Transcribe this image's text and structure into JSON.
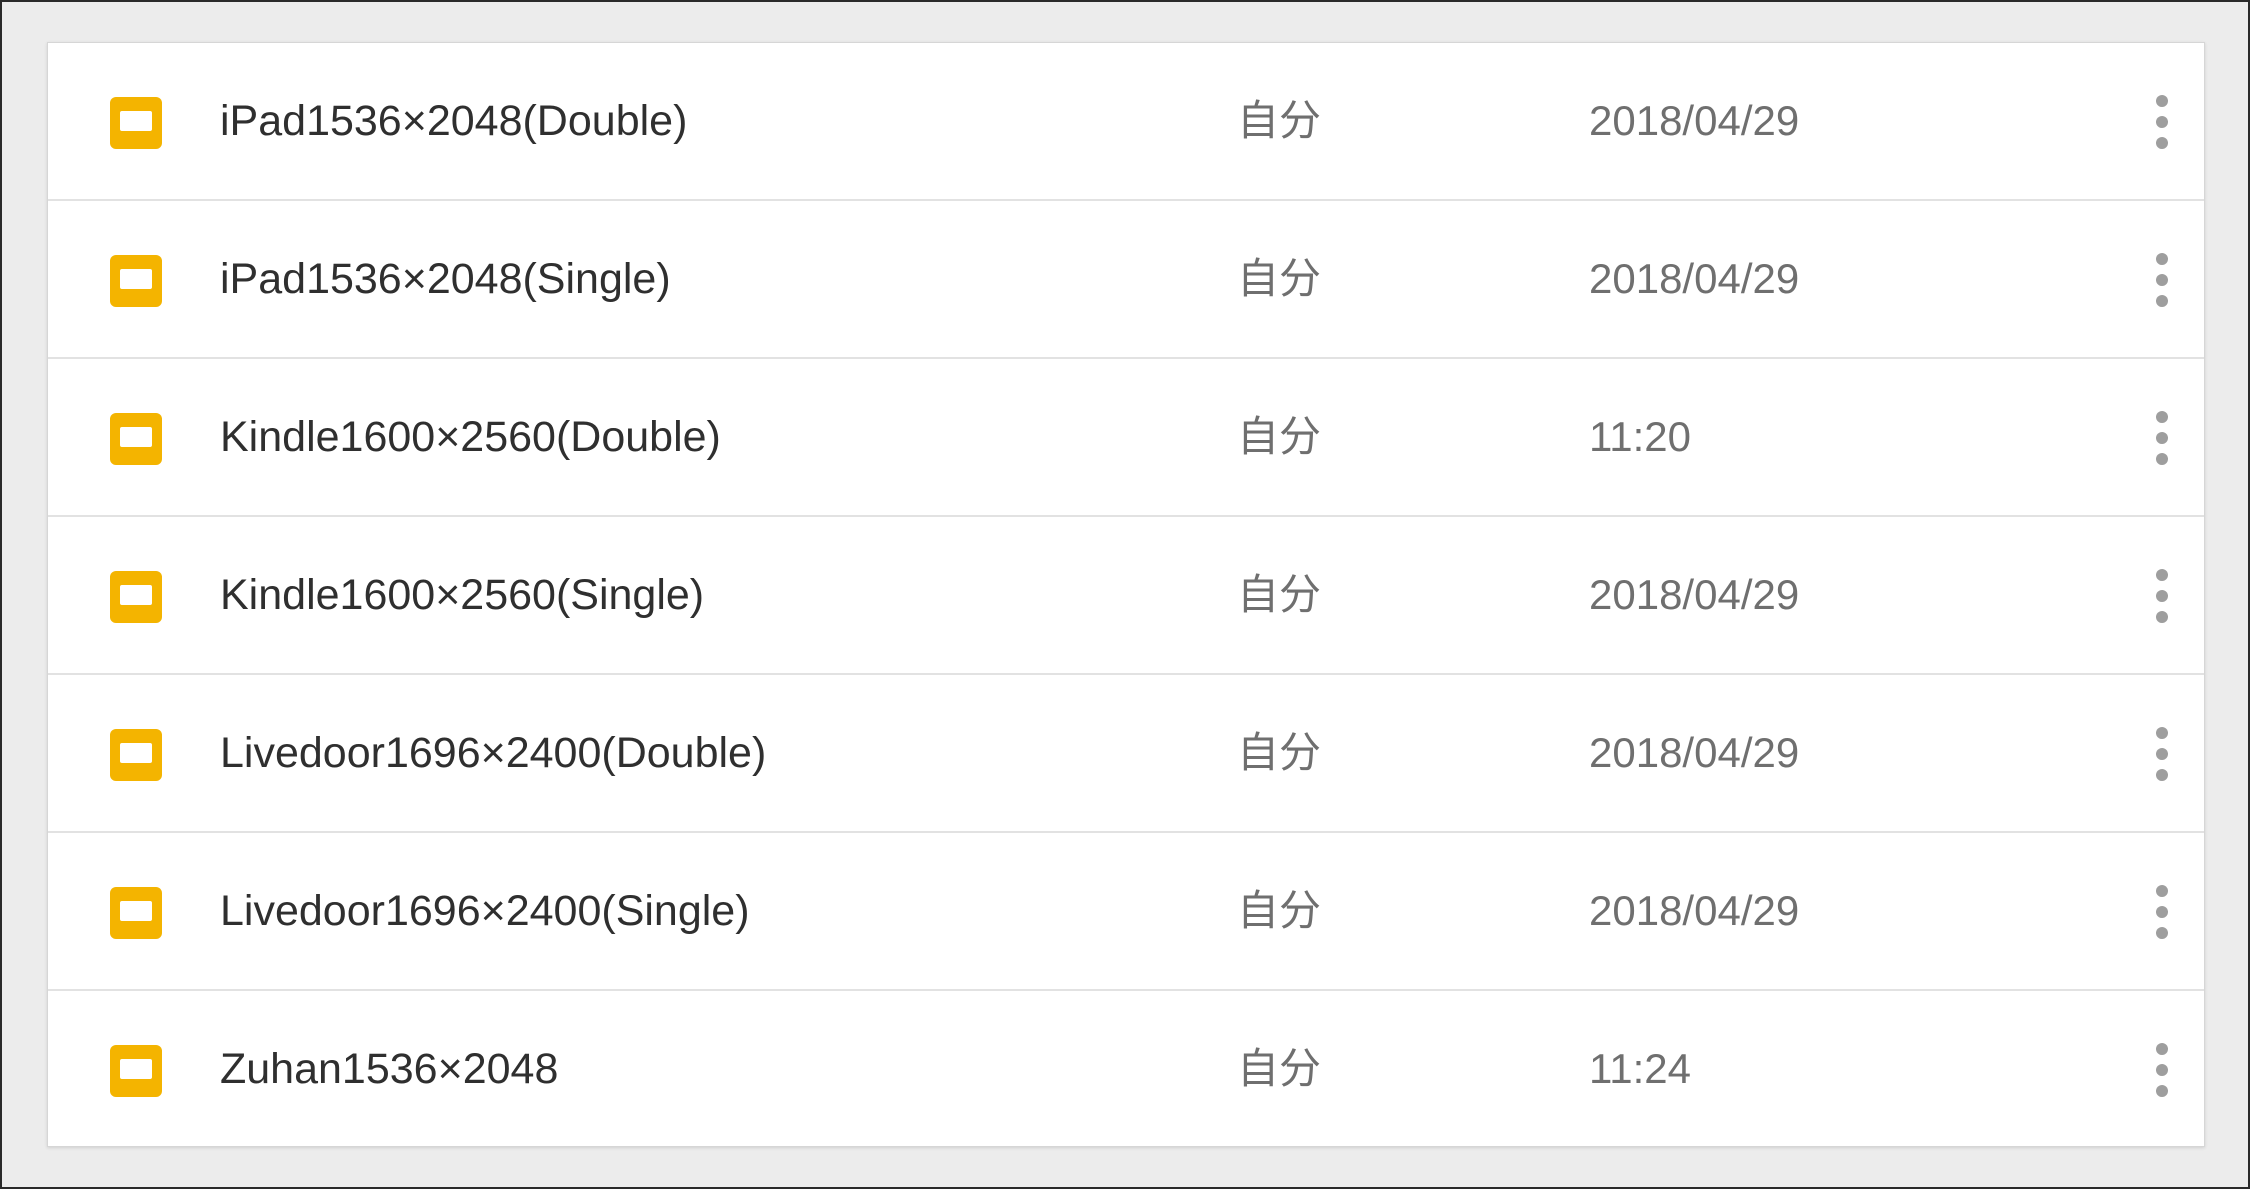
{
  "files": [
    {
      "name": "iPad1536×2048(Double)",
      "owner": "自分",
      "modified": "2018/04/29",
      "icon": "slides-icon"
    },
    {
      "name": "iPad1536×2048(Single)",
      "owner": "自分",
      "modified": "2018/04/29",
      "icon": "slides-icon"
    },
    {
      "name": "Kindle1600×2560(Double)",
      "owner": "自分",
      "modified": "11:20",
      "icon": "slides-icon"
    },
    {
      "name": "Kindle1600×2560(Single)",
      "owner": "自分",
      "modified": "2018/04/29",
      "icon": "slides-icon"
    },
    {
      "name": "Livedoor1696×2400(Double)",
      "owner": "自分",
      "modified": "2018/04/29",
      "icon": "slides-icon"
    },
    {
      "name": "Livedoor1696×2400(Single)",
      "owner": "自分",
      "modified": "2018/04/29",
      "icon": "slides-icon"
    },
    {
      "name": "Zuhan1536×2048",
      "owner": "自分",
      "modified": "11:24",
      "icon": "slides-icon"
    }
  ],
  "colors": {
    "icon": "#f4b400",
    "background": "#ececec",
    "list_background": "#ffffff",
    "name_text": "#2f2f2f",
    "meta_text": "#6f6f6f",
    "menu_dots": "#9e9e9e"
  },
  "row_menu_icon": "more-vert-icon"
}
